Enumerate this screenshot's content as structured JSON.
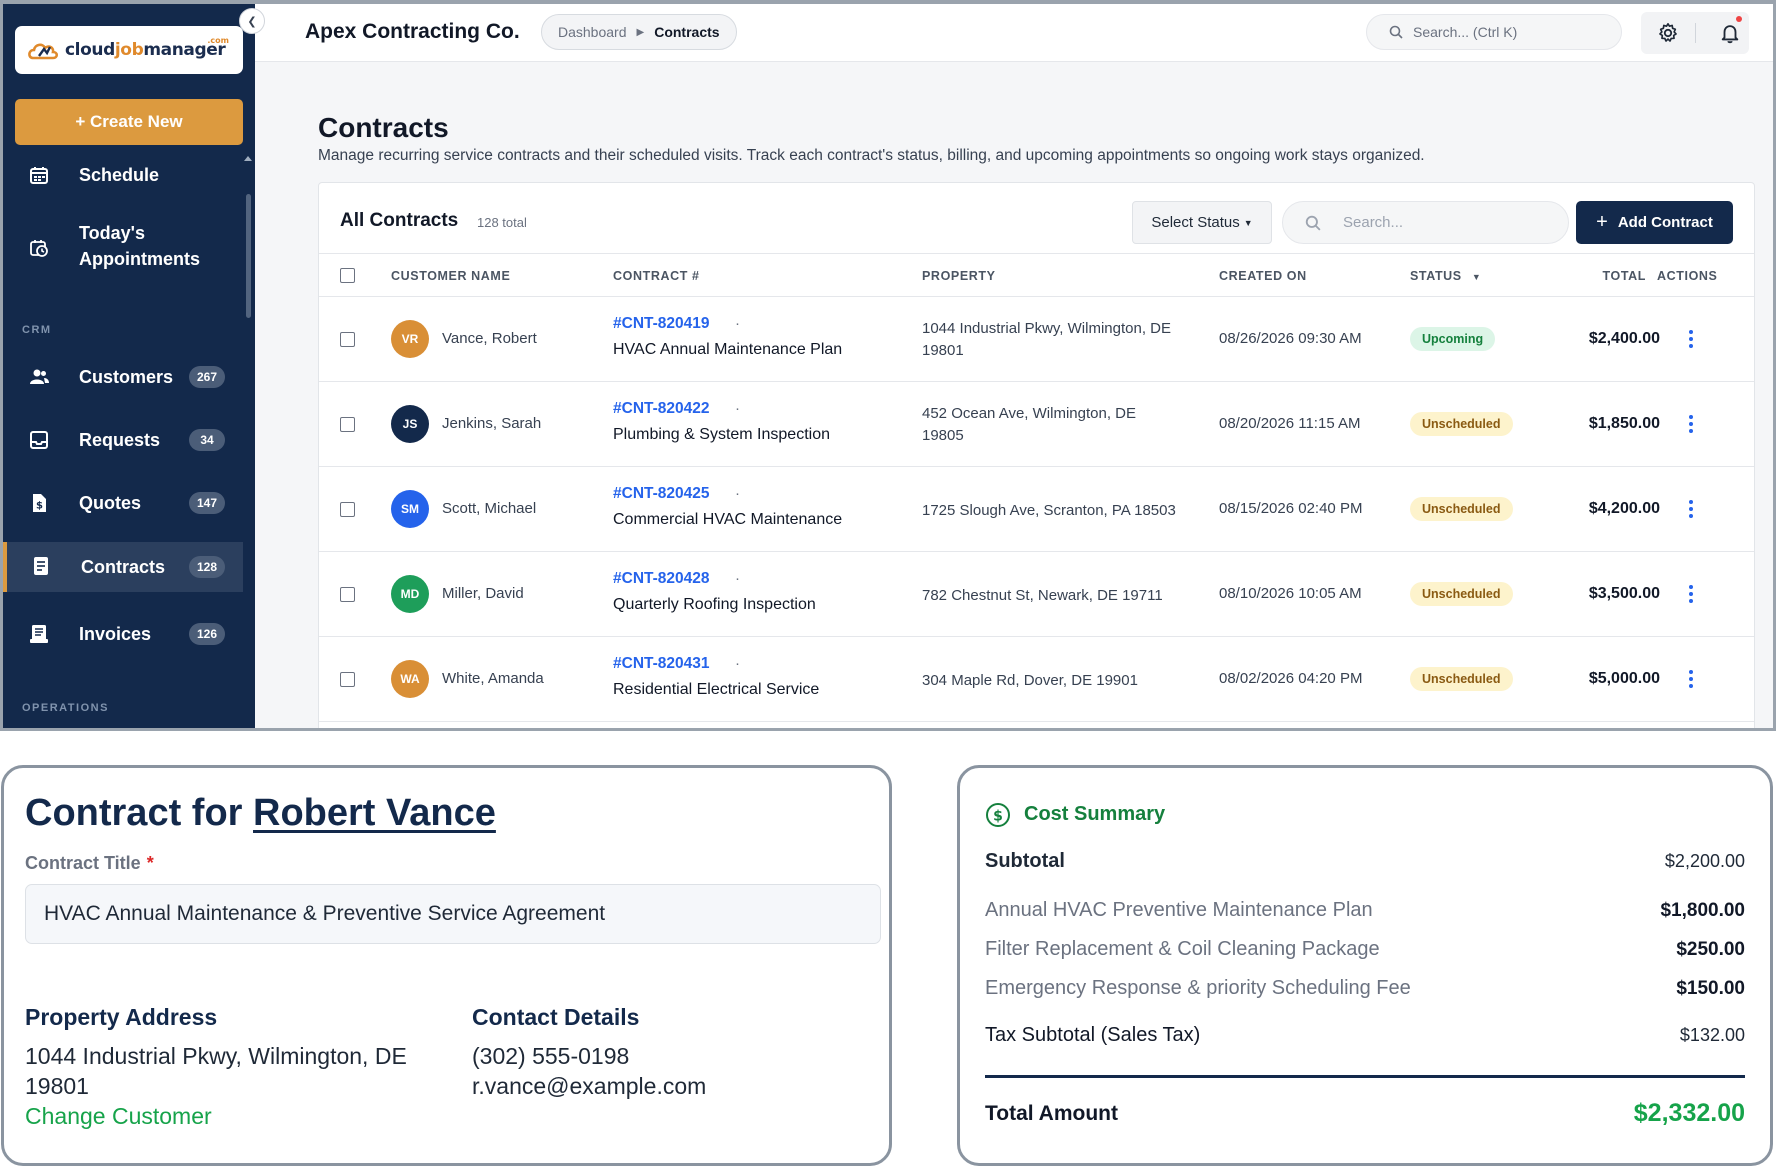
{
  "brand": {
    "logo_text_a": "cloud",
    "logo_text_b": "job",
    "logo_text_c": "manager",
    "logo_com": ".com"
  },
  "sidebar": {
    "create_label": "+ Create New",
    "items_top": [
      {
        "label": "Schedule",
        "icon": "calendar-icon"
      },
      {
        "label_line1": "Today's",
        "label_line2": "Appointments",
        "icon": "calendar-clock-icon"
      }
    ],
    "section_crm": "CRM",
    "crm_items": [
      {
        "label": "Customers",
        "badge": "267",
        "icon": "users-icon"
      },
      {
        "label": "Requests",
        "badge": "34",
        "icon": "inbox-icon"
      },
      {
        "label": "Quotes",
        "badge": "147",
        "icon": "dollar-file-icon"
      },
      {
        "label": "Contracts",
        "badge": "128",
        "icon": "contract-icon",
        "active": true
      },
      {
        "label": "Invoices",
        "badge": "126",
        "icon": "invoice-icon"
      }
    ],
    "section_ops": "OPERATIONS"
  },
  "header": {
    "company": "Apex Contracting Co.",
    "breadcrumb": [
      "Dashboard",
      "Contracts"
    ],
    "search_placeholder": "Search... (Ctrl K)"
  },
  "main": {
    "title": "Contracts",
    "description": "Manage recurring service contracts and their scheduled visits. Track each contract's status, billing, and upcoming appointments so ongoing work stays organized.",
    "card_title": "All Contracts",
    "card_count": "128 total",
    "status_select": "Select Status",
    "search_placeholder": "Search...",
    "add_label": "Add Contract",
    "columns": [
      "CUSTOMER NAME",
      "CONTRACT #",
      "PROPERTY",
      "CREATED ON",
      "STATUS",
      "TOTAL",
      "ACTIONS"
    ],
    "rows": [
      {
        "initials": "VR",
        "avatar_color": "#d98f36",
        "customer": "Vance, Robert",
        "number": "#CNT-820419",
        "title": "HVAC Annual Maintenance Plan",
        "property_line1": "1044 Industrial Pkwy, Wilmington, DE",
        "property_line2": "19801",
        "created": "08/26/2026 09:30 AM",
        "status": "Upcoming",
        "total": "$2,400.00"
      },
      {
        "initials": "JS",
        "avatar_color": "#13294b",
        "customer": "Jenkins, Sarah",
        "number": "#CNT-820422",
        "title": "Plumbing & System Inspection",
        "property_line1": "452 Ocean Ave, Wilmington, DE",
        "property_line2": "19805",
        "created": "08/20/2026 11:15 AM",
        "status": "Unscheduled",
        "total": "$1,850.00"
      },
      {
        "initials": "SM",
        "avatar_color": "#2563eb",
        "customer": "Scott, Michael",
        "number": "#CNT-820425",
        "title": "Commercial HVAC Maintenance",
        "property_line1": "1725 Slough Ave, Scranton, PA 18503",
        "property_line2": "",
        "created": "08/15/2026 02:40 PM",
        "status": "Unscheduled",
        "total": "$4,200.00"
      },
      {
        "initials": "MD",
        "avatar_color": "#1e9e5a",
        "customer": "Miller, David",
        "number": "#CNT-820428",
        "title": "Quarterly Roofing Inspection",
        "property_line1": "782 Chestnut St, Newark, DE 19711",
        "property_line2": "",
        "created": "08/10/2026 10:05 AM",
        "status": "Unscheduled",
        "total": "$3,500.00"
      },
      {
        "initials": "WA",
        "avatar_color": "#d98f36",
        "customer": "White, Amanda",
        "number": "#CNT-820431",
        "title": "Residential Electrical Service",
        "property_line1": "304 Maple Rd, Dover, DE 19901",
        "property_line2": "",
        "created": "08/02/2026 04:20 PM",
        "status": "Unscheduled",
        "total": "$5,000.00"
      }
    ]
  },
  "contract_detail": {
    "title_prefix": "Contract for",
    "customer_name": "Robert Vance",
    "title_label": "Contract Title",
    "required_mark": "*",
    "title_value": "HVAC Annual Maintenance & Preventive Service Agreement",
    "property_heading": "Property Address",
    "property_line1": "1044 Industrial Pkwy, Wilmington, DE",
    "property_line2": "19801",
    "change_customer": "Change Customer",
    "contact_heading": "Contact Details",
    "phone": "(302) 555-0198",
    "email": "r.vance@example.com"
  },
  "cost_summary": {
    "heading": "Cost Summary",
    "subtotal_label": "Subtotal",
    "subtotal_value": "$2,200.00",
    "items": [
      {
        "label": "Annual HVAC Preventive Maintenance Plan",
        "value": "$1,800.00"
      },
      {
        "label": "Filter Replacement & Coil Cleaning Package",
        "value": "$250.00"
      },
      {
        "label": "Emergency Response & priority Scheduling Fee",
        "value": "$150.00"
      }
    ],
    "tax_label": "Tax Subtotal (Sales Tax)",
    "tax_value": "$132.00",
    "total_label": "Total Amount",
    "total_value": "$2,332.00"
  }
}
